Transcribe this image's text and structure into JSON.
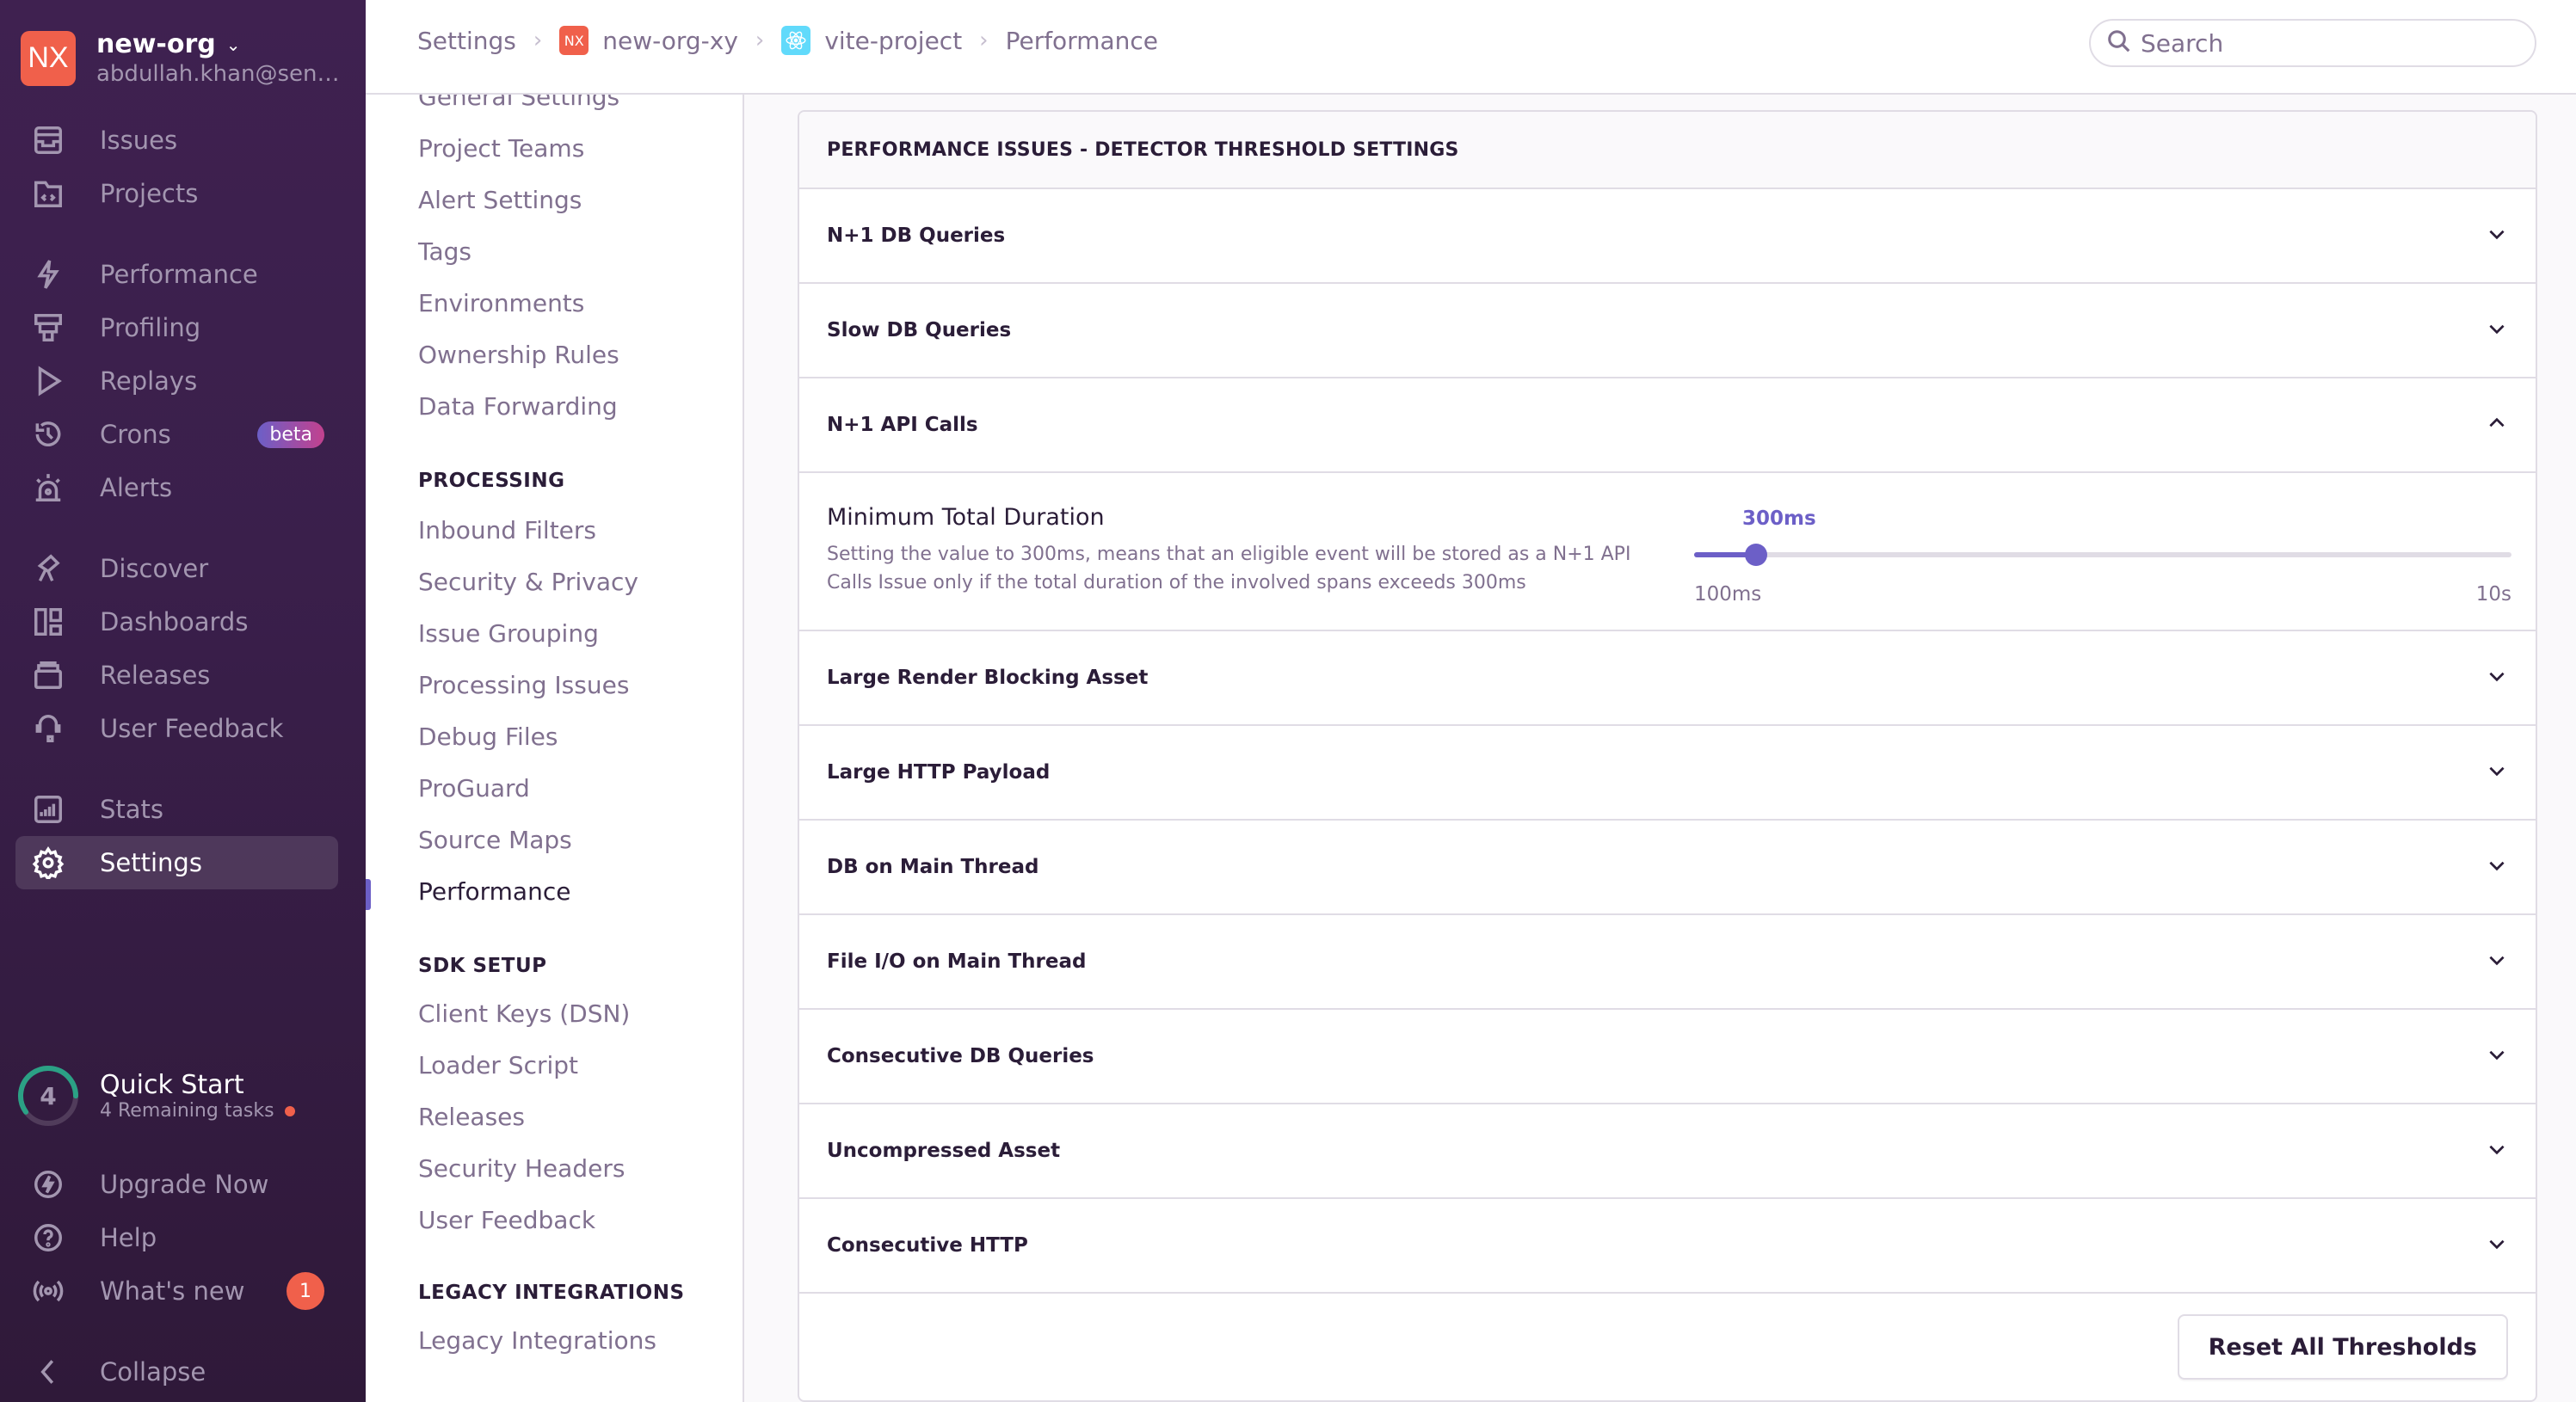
{
  "org": {
    "initials": "NX",
    "name": "new-org",
    "email": "abdullah.khan@sen…"
  },
  "sidebar": {
    "primary": [
      {
        "label": "Issues",
        "icon": "issues-icon"
      },
      {
        "label": "Projects",
        "icon": "projects-icon"
      }
    ],
    "secondary": [
      {
        "label": "Performance",
        "icon": "performance-icon"
      },
      {
        "label": "Profiling",
        "icon": "profiling-icon"
      },
      {
        "label": "Replays",
        "icon": "replays-icon"
      },
      {
        "label": "Crons",
        "icon": "crons-icon",
        "badge": "beta"
      },
      {
        "label": "Alerts",
        "icon": "alerts-icon"
      }
    ],
    "tertiary": [
      {
        "label": "Discover",
        "icon": "discover-icon"
      },
      {
        "label": "Dashboards",
        "icon": "dashboards-icon"
      },
      {
        "label": "Releases",
        "icon": "releases-icon"
      },
      {
        "label": "User Feedback",
        "icon": "user-feedback-icon"
      }
    ],
    "quaternary": [
      {
        "label": "Stats",
        "icon": "stats-icon"
      },
      {
        "label": "Settings",
        "icon": "settings-icon",
        "active": true
      }
    ],
    "quick_start": {
      "count": "4",
      "title": "Quick Start",
      "subtitle": "4 Remaining tasks",
      "progress": 0.6
    },
    "footer": [
      {
        "label": "Upgrade Now",
        "icon": "upgrade-icon"
      },
      {
        "label": "Help",
        "icon": "help-icon"
      },
      {
        "label": "What's new",
        "icon": "broadcast-icon",
        "count": "1"
      }
    ],
    "collapse": "Collapse"
  },
  "breadcrumbs": [
    {
      "label": "Settings"
    },
    {
      "label": "new-org-xy",
      "avatar": "NX"
    },
    {
      "label": "vite-project",
      "avatar": "react"
    },
    {
      "label": "Performance"
    }
  ],
  "search": {
    "placeholder": "Search"
  },
  "settings_nav": {
    "general": [
      "General Settings",
      "Project Teams",
      "Alert Settings",
      "Tags",
      "Environments",
      "Ownership Rules",
      "Data Forwarding"
    ],
    "processing_title": "PROCESSING",
    "processing": [
      "Inbound Filters",
      "Security & Privacy",
      "Issue Grouping",
      "Processing Issues",
      "Debug Files",
      "ProGuard",
      "Source Maps",
      "Performance"
    ],
    "sdk_title": "SDK SETUP",
    "sdk": [
      "Client Keys (DSN)",
      "Loader Script",
      "Releases",
      "Security Headers",
      "User Feedback"
    ],
    "legacy_title": "LEGACY INTEGRATIONS",
    "legacy": [
      "Legacy Integrations"
    ],
    "active": "Performance"
  },
  "panel": {
    "title": "PERFORMANCE ISSUES - DETECTOR THRESHOLD SETTINGS",
    "rows_before": [
      "N+1 DB Queries",
      "Slow DB Queries"
    ],
    "expanded": {
      "label": "N+1 API Calls",
      "setting_title": "Minimum Total Duration",
      "setting_desc": "Setting the value to 300ms, means that an eligible event will be stored as a N+1 API Calls Issue only if the total duration of the involved spans exceeds 300ms",
      "value_label": "300ms",
      "min_label": "100ms",
      "max_label": "10s",
      "position": 0.0253
    },
    "rows_after": [
      "Large Render Blocking Asset",
      "Large HTTP Payload",
      "DB on Main Thread",
      "File I/O on Main Thread",
      "Consecutive DB Queries",
      "Uncompressed Asset",
      "Consecutive HTTP"
    ],
    "reset_label": "Reset All Thresholds"
  },
  "colors": {
    "accent": "#6c5fc7",
    "brand_org": "#f0604b",
    "sidebar": "#3f2150",
    "progress": "#2ba185"
  }
}
